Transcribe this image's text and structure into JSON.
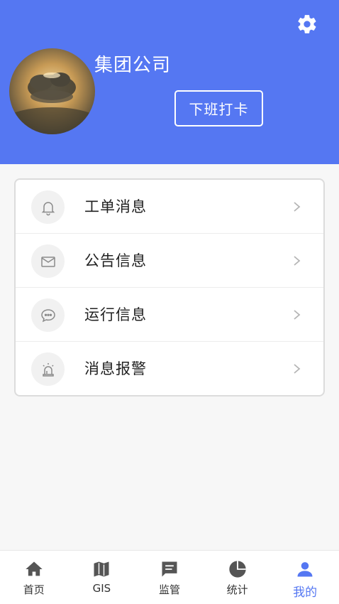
{
  "header": {
    "company_name": "集团公司",
    "clock_out_label": "下班打卡",
    "settings_icon": "gear-icon",
    "accent_color": "#5577f2"
  },
  "menu": [
    {
      "label": "工单消息",
      "icon": "bell-icon"
    },
    {
      "label": "公告信息",
      "icon": "envelope-icon"
    },
    {
      "label": "运行信息",
      "icon": "chat-bubble-icon"
    },
    {
      "label": "消息报警",
      "icon": "alarm-siren-icon"
    }
  ],
  "tabbar": [
    {
      "label": "首页",
      "icon": "home-icon",
      "active": false
    },
    {
      "label": "GIS",
      "icon": "map-icon",
      "active": false
    },
    {
      "label": "监管",
      "icon": "message-icon",
      "active": false
    },
    {
      "label": "统计",
      "icon": "pie-chart-icon",
      "active": false
    },
    {
      "label": "我的",
      "icon": "user-icon",
      "active": true
    }
  ]
}
